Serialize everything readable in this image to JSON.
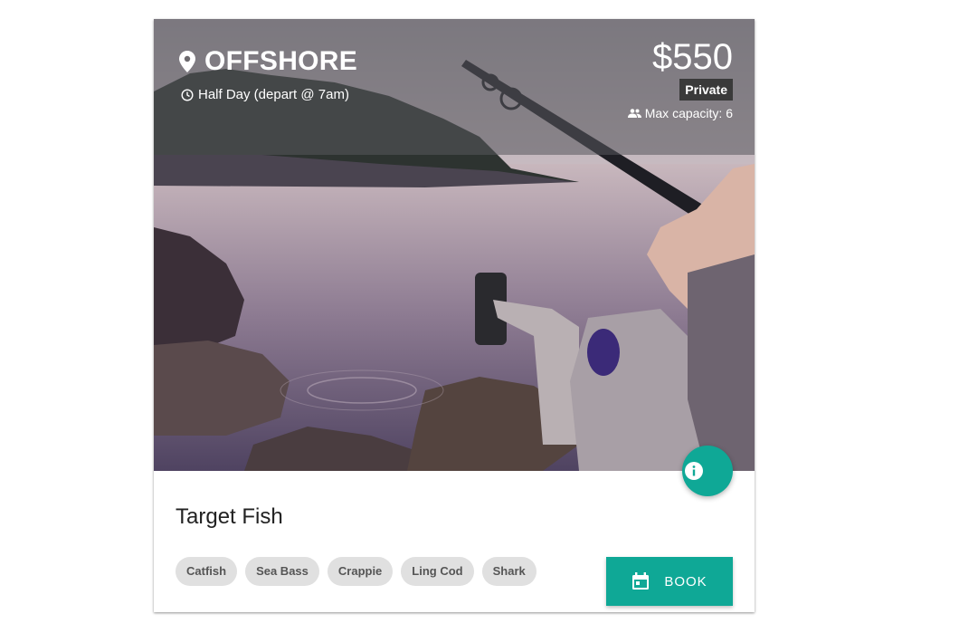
{
  "card": {
    "title": "OFFSHORE",
    "duration": "Half Day (depart @ 7am)",
    "price": "$550",
    "badge": "Private",
    "capacity": "Max capacity: 6",
    "section_title": "Target Fish",
    "fish": [
      "Catfish",
      "Sea Bass",
      "Crappie",
      "Ling Cod",
      "Shark"
    ],
    "book_label": "BOOK"
  },
  "icons": {
    "location": "location-pin-icon",
    "duration": "clock-icon",
    "capacity": "people-icon",
    "info": "info-icon",
    "book": "calendar-icon"
  },
  "colors": {
    "accent": "#0fa896",
    "badge_bg": "#3a3a3a",
    "chip_bg": "#e0e0e0"
  }
}
